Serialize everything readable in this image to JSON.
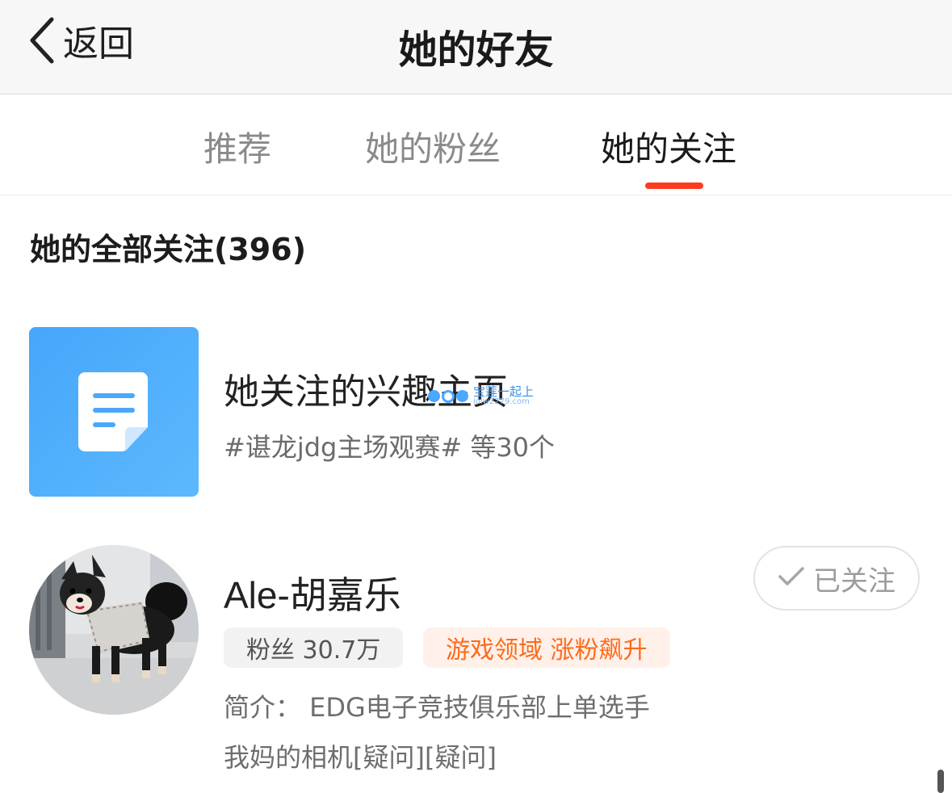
{
  "nav": {
    "back_label": "返回",
    "title": "她的好友"
  },
  "tabs": [
    {
      "label": "推荐",
      "active": false
    },
    {
      "label": "她的粉丝",
      "active": false
    },
    {
      "label": "她的关注",
      "active": true
    }
  ],
  "section": {
    "title": "她的全部关注(396)"
  },
  "interest_card": {
    "title": "她关注的兴趣主页",
    "subtitle": "#谌龙jdg主场观赛# 等30个",
    "icon": "document-icon",
    "icon_color": "#4aa8fb"
  },
  "watermark": {
    "text": "宝莲一起上",
    "sub": "ioiw2279.com"
  },
  "user": {
    "name": "Ale-胡嘉乐",
    "follow_label": "已关注",
    "fans_tag": "粉丝 30.7万",
    "hot_tag": "游戏领域 涨粉飙升",
    "bio_line1": "简介：  EDG电子竞技俱乐部上单选手",
    "bio_line2": "我妈的相机[疑问][疑问]"
  },
  "colors": {
    "accent": "#ff3b1f",
    "hot_tag_text": "#ff6a1a",
    "hot_tag_bg": "#fff1ea"
  }
}
